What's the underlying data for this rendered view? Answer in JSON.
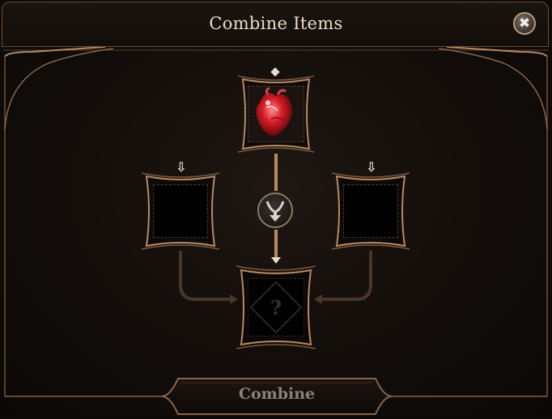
{
  "window": {
    "title": "Combine Items",
    "close_icon": "close-icon"
  },
  "slots": {
    "top": {
      "item": "red-heart-item-icon",
      "filled": true
    },
    "left": {
      "filled": false
    },
    "right": {
      "filled": false
    },
    "result": {
      "placeholder": "?",
      "filled": false
    }
  },
  "combine_icon": "combine-symbol-icon",
  "combine_button": {
    "label": "Combine",
    "enabled": false
  },
  "colors": {
    "frame": "#b88a63",
    "frame_dark": "#6b4a34",
    "title_text": "#e9dcc6",
    "disabled_text": "#8d8077"
  }
}
